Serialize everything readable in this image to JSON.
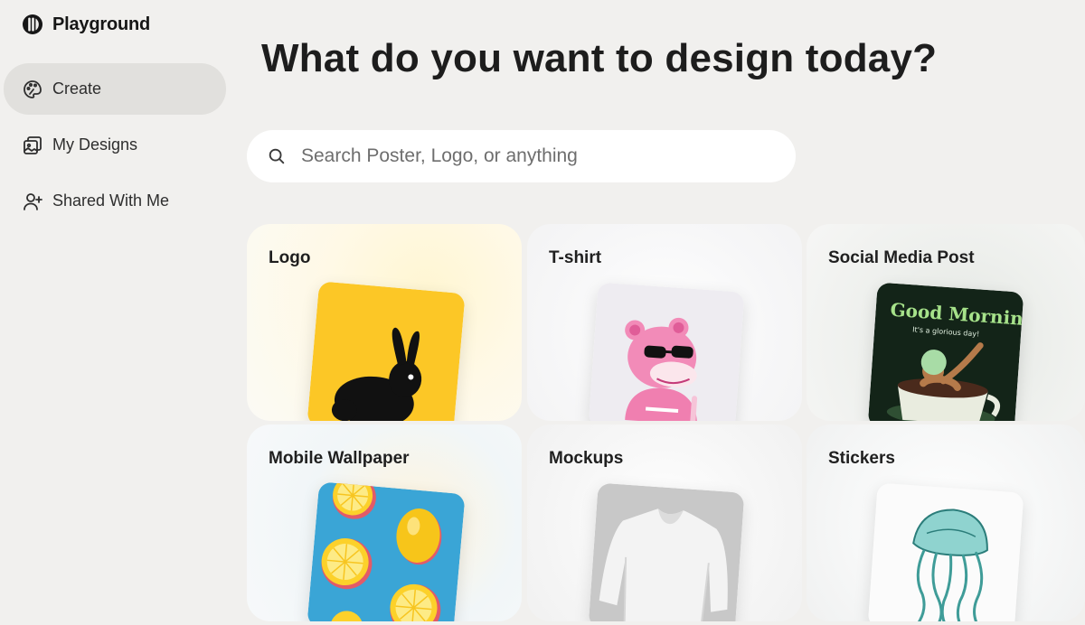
{
  "app": {
    "name": "Playground"
  },
  "sidebar": {
    "items": [
      {
        "label": "Create",
        "icon": "palette-icon",
        "active": true
      },
      {
        "label": "My Designs",
        "icon": "images-icon",
        "active": false
      },
      {
        "label": "Shared With Me",
        "icon": "user-plus-icon",
        "active": false
      }
    ]
  },
  "main": {
    "title": "What do you want to design today?",
    "search": {
      "placeholder": "Search Poster, Logo, or anything",
      "value": ""
    },
    "cards": [
      {
        "label": "Logo",
        "thumbnail": "black-rabbit-on-yellow"
      },
      {
        "label": "T-shirt",
        "thumbnail": "pink-panther-with-sunglasses"
      },
      {
        "label": "Social Media Post",
        "thumbnail": "good-morning-coffee-cup",
        "thumb_title": "Good Morning",
        "thumb_subtitle": "It's a glorious day!"
      },
      {
        "label": "Mobile Wallpaper",
        "thumbnail": "lemons-on-blue"
      },
      {
        "label": "Mockups",
        "thumbnail": "white-sweatshirt"
      },
      {
        "label": "Stickers",
        "thumbnail": "teal-jellyfish"
      }
    ]
  },
  "colors": {
    "background": "#f1f0ee",
    "active_nav": "#e1e0dd",
    "card": "#fafafa"
  }
}
